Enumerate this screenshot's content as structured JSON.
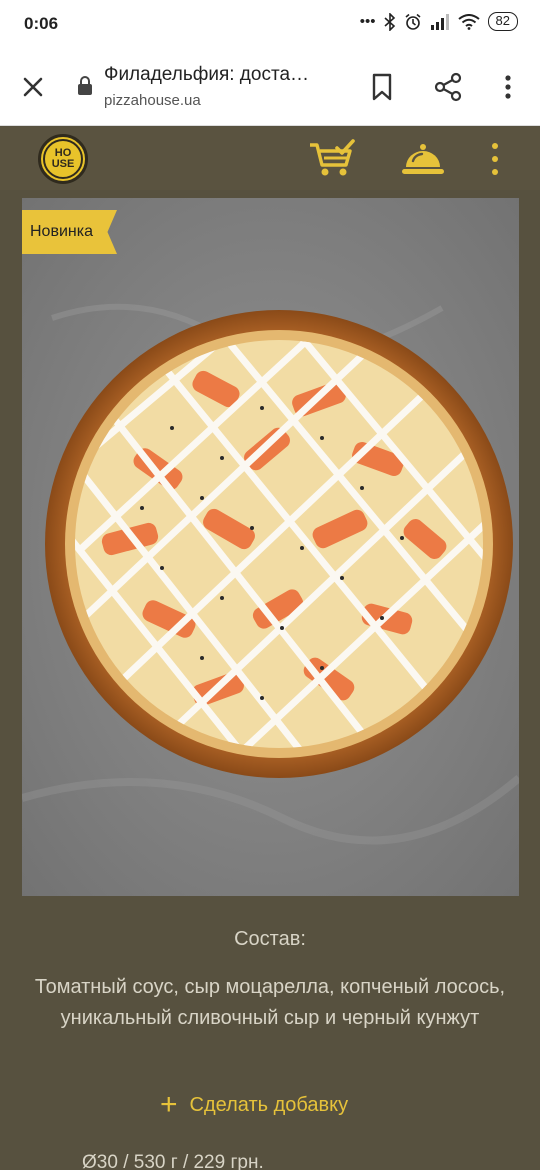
{
  "status_bar": {
    "time": "0:06",
    "battery": "82",
    "icons": [
      "dots-icon",
      "bluetooth-icon",
      "alarm-icon",
      "signal-icon",
      "wifi-icon"
    ]
  },
  "browser": {
    "page_title": "Филадельфия: доста…",
    "url": "pizzahouse.ua"
  },
  "header": {
    "logo_line1": "HO",
    "logo_line2": "USE"
  },
  "product": {
    "badge": "Новинка",
    "composition_title": "Состав:",
    "composition_text": "Томатный соус, сыр моцарелла, копченый лосось, уникальный сливочный сыр и черный кунжут",
    "addon_label": "Сделать добавку",
    "size_info": "Ø30 / 530 г / 229 грн."
  },
  "colors": {
    "accent": "#e6c23a",
    "header_bg": "#5a5340",
    "page_bg": "#57513f",
    "text_light": "#d8d4c6"
  }
}
